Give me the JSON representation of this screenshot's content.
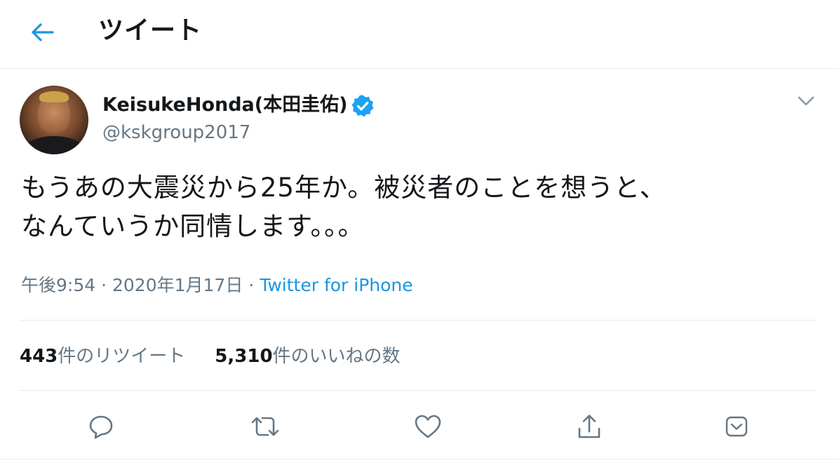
{
  "header": {
    "title": "ツイート",
    "back_icon": "arrow-left-icon"
  },
  "colors": {
    "accent": "#1b95e0",
    "text": "#14171a",
    "secondary": "#657786",
    "border": "#e6ecf0"
  },
  "tweet": {
    "author": {
      "display_name": "KeisukeHonda(本田圭佑)",
      "handle": "@kskgroup2017",
      "verified_icon": "verified-badge-icon"
    },
    "text_lines": [
      "もうあの大震災から25年か。被災者のことを想うと、",
      "なんていうか同情します。。。"
    ],
    "time": "午後9:54",
    "date": "2020年1月17日",
    "separator": "·",
    "source": "Twitter for iPhone",
    "stats": {
      "retweets_count": "443",
      "retweets_label": "件のリツイート",
      "likes_count": "5,310",
      "likes_label": "件のいいねの数"
    },
    "actions": [
      "reply-icon",
      "retweet-icon",
      "like-icon",
      "share-icon",
      "bookmark-icon"
    ]
  }
}
